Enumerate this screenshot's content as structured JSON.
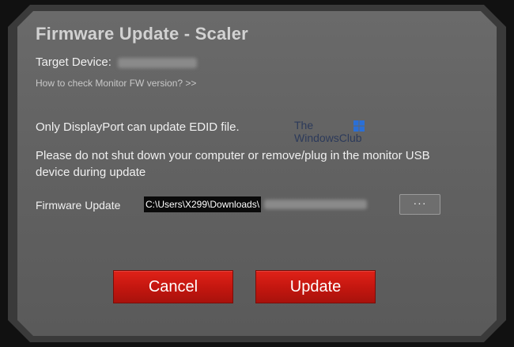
{
  "dialog": {
    "title": "Firmware Update - Scaler",
    "target_label": "Target Device:",
    "fw_link": "How to check Monitor FW version? >>",
    "message_edid": "Only DisplayPort can update EDID file.",
    "message_warning": "Please do not shut down your computer or remove/plug in the monitor USB device during update",
    "firmware_label": "Firmware Update",
    "firmware_path": "C:\\Users\\X299\\Downloads\\",
    "browse_label": "···",
    "cancel_label": "Cancel",
    "update_label": "Update"
  },
  "watermark": {
    "line1": "The",
    "line2": "WindowsClub"
  },
  "colors": {
    "button_red": "#c2160f",
    "dialog_bg": "#626262",
    "title_text": "#d2d2d2"
  }
}
